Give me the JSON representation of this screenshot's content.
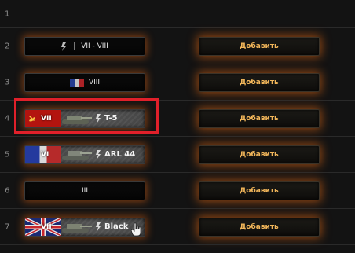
{
  "rows": [
    {
      "num": "1"
    },
    {
      "num": "2",
      "slot_text": "VII - VIII",
      "button": "Добавить"
    },
    {
      "num": "3",
      "slot_text": "VIII",
      "button": "Добавить"
    },
    {
      "num": "4",
      "tier": "VII",
      "tank": "T-5",
      "button": "Добавить"
    },
    {
      "num": "5",
      "tier": "VI",
      "tank": "ARL 44",
      "button": "Добавить"
    },
    {
      "num": "6",
      "slot_text": "III",
      "button": "Добавить"
    },
    {
      "num": "7",
      "tier": "VII",
      "tank": "Black",
      "button": "Добавить"
    }
  ],
  "colors": {
    "highlight": "#e0202a",
    "button_text": "#f2b65a",
    "glow": "#ff7314"
  },
  "icons": {
    "vehicle_type": "heavy-tank-icon",
    "cursor": "hand-pointer-icon"
  }
}
